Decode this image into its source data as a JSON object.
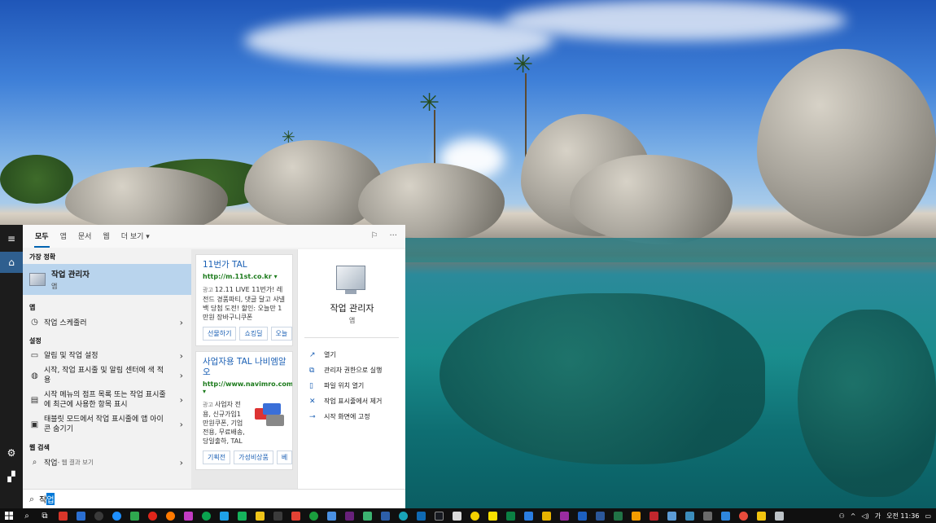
{
  "desktop": {
    "wallpaper": "tropical beach boulders, half underwater"
  },
  "start_rail": {
    "items": [
      {
        "icon": "hamburger-icon",
        "glyph": "≡"
      },
      {
        "icon": "home-icon",
        "glyph": "⌂"
      },
      {
        "icon": "gear-icon",
        "glyph": "⚙"
      },
      {
        "icon": "user-icon",
        "glyph": "▞"
      }
    ]
  },
  "tabs": {
    "items": [
      "모두",
      "앱",
      "문서",
      "웹",
      "더 보기 ▾"
    ],
    "active": "모두"
  },
  "results": {
    "best_match_header": "가장 정확",
    "best_match": {
      "title": "작업 관리자",
      "subtitle": "앱"
    },
    "apps_header": "앱",
    "apps": [
      {
        "label": "작업 스케줄러"
      }
    ],
    "settings_header": "설정",
    "settings": [
      {
        "label": "알림 및 작업 설정"
      },
      {
        "label": "시작, 작업 표시줄 및 알림 센터에 색 적용"
      },
      {
        "label": "시작 메뉴의 점프 목록 또는 작업 표시줄에 최근에 사용한 항목 표시"
      },
      {
        "label": "태블릿 모드에서 작업 표시줄에 앱 아이콘 숨기기"
      }
    ],
    "web_header": "웹 검색",
    "web": {
      "query": "작업",
      "hint": " - 웹 결과 보기"
    }
  },
  "ads": [
    {
      "title": "11번가 TAL",
      "url": "http://m.11st.co.kr",
      "tag": "광고",
      "body": "12.11 LIVE 11번가! 레전드 경품파티, 댓글 달고 샤넬백 당첨 도전! 할인: 오늘만 1만원 장바구니쿠폰",
      "chips": [
        "선물하기",
        "쇼킹딜",
        "오늘"
      ]
    },
    {
      "title": "사업자용 TAL 나비엠알오",
      "url": "http://www.navimro.com",
      "tag": "광고",
      "body": "사업자 전용, 신규가입1만원쿠폰, 기업전용, 무료배송, 당일출하, TAL",
      "chips": [
        "기획전",
        "가성비상품",
        "베"
      ]
    }
  ],
  "preview": {
    "title": "작업 관리자",
    "subtitle": "앱",
    "actions": [
      {
        "icon": "open-icon",
        "label": "열기"
      },
      {
        "icon": "run-as-admin-icon",
        "label": "관리자 권한으로 실행"
      },
      {
        "icon": "file-location-icon",
        "label": "파일 위치 열기"
      },
      {
        "icon": "unpin-taskbar-icon",
        "label": "작업 표시줄에서 제거"
      },
      {
        "icon": "pin-start-icon",
        "label": "시작 화면에 고정"
      }
    ]
  },
  "searchbox": {
    "typed": "작",
    "selected": "업"
  },
  "taskbar": {
    "tray": {
      "ime": "가",
      "time": "오전 11:36"
    }
  }
}
